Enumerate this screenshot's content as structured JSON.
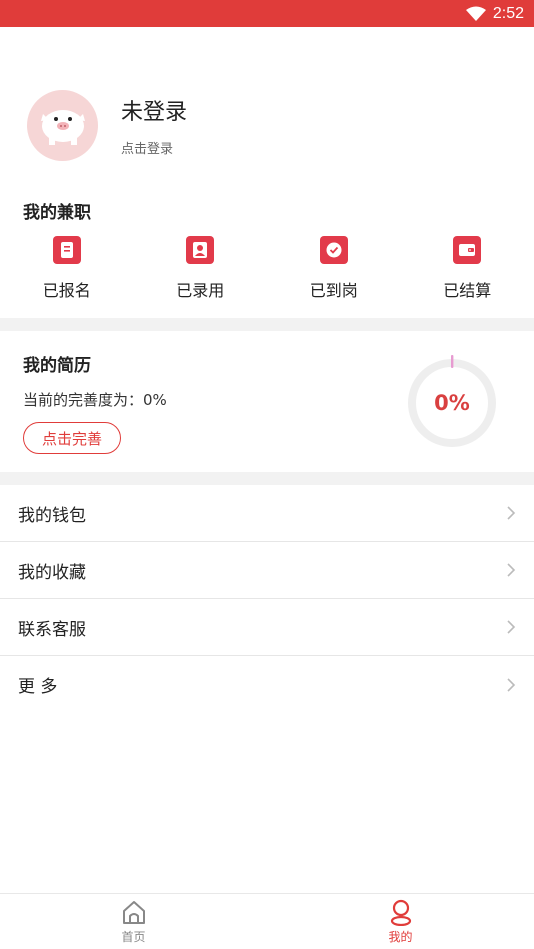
{
  "status_bar": {
    "time": "2:52",
    "wifi_icon": "wifi-icon"
  },
  "profile": {
    "name": "未登录",
    "subtitle": "点击登录",
    "avatar_icon": "pig-avatar-icon"
  },
  "part_time": {
    "title": "我的兼职",
    "items": [
      {
        "label": "已报名",
        "icon": "document-icon"
      },
      {
        "label": "已录用",
        "icon": "person-icon"
      },
      {
        "label": "已到岗",
        "icon": "check-circle-icon"
      },
      {
        "label": "已结算",
        "icon": "wallet-icon"
      }
    ]
  },
  "resume": {
    "title": "我的简历",
    "status": "当前的完善度为：0%",
    "button": "点击完善",
    "progress_text": "0%",
    "progress_value": 0
  },
  "menu": [
    {
      "label": "我的钱包"
    },
    {
      "label": "我的收藏"
    },
    {
      "label": "联系客服"
    },
    {
      "label": "更 多"
    }
  ],
  "tabs": [
    {
      "label": "首页",
      "icon": "home-icon",
      "active": false
    },
    {
      "label": "我的",
      "icon": "user-icon",
      "active": true
    }
  ],
  "colors": {
    "accent": "#e03c3a",
    "icon_red": "#e23a4a",
    "inactive": "#888888"
  }
}
